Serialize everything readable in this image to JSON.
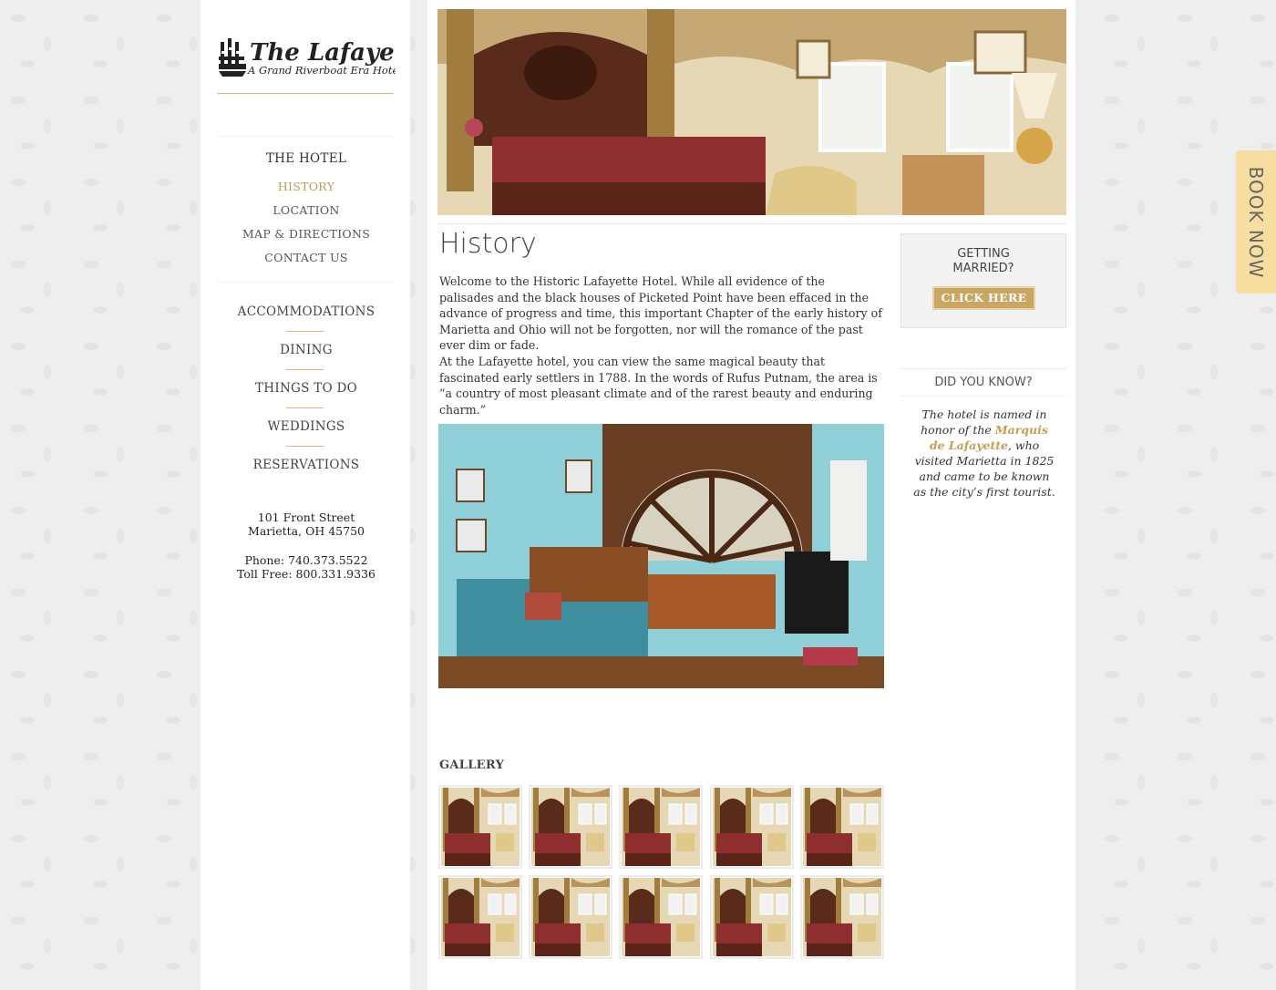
{
  "logo": {
    "name": "The Lafayette",
    "tagline": "A Grand Riverboat Era Hotel"
  },
  "nav": {
    "section_head": "THE HOTEL",
    "sub_items": [
      {
        "label": "HISTORY",
        "active": true
      },
      {
        "label": "LOCATION",
        "active": false
      },
      {
        "label": "MAP & DIRECTIONS",
        "active": false
      },
      {
        "label": "CONTACT US",
        "active": false
      }
    ],
    "main_items": [
      {
        "label": "ACCOMMODATIONS"
      },
      {
        "label": "DINING"
      },
      {
        "label": "THINGS TO DO"
      },
      {
        "label": "WEDDINGS"
      },
      {
        "label": "RESERVATIONS"
      }
    ]
  },
  "address": {
    "street": "101 Front Street",
    "city": "Marietta, OH 45750",
    "phone": "Phone: 740.373.5522",
    "toll_free": "Toll Free: 800.331.9336"
  },
  "main": {
    "title": "History",
    "paragraph_1": "Welcome to the Historic Lafayette Hotel. While all evidence of the palisades and the black houses of Picketed Point have been effaced in the advance of progress and time, this important Chapter of the early history of Marietta and Ohio will not be forgotten, nor will the romance of the past ever dim or fade.",
    "paragraph_2": "At the Lafayette hotel, you can view the same magical beauty that fascinated early settlers in 1788. In the words of Rufus Putnam, the area is “a country of most pleasant climate and of the rarest beauty and enduring charm.”",
    "gallery_title": "GALLERY"
  },
  "wedding_box": {
    "line_1": "GETTING",
    "line_2": "MARRIED?",
    "button": "CLICK HERE"
  },
  "did_you_know": {
    "title": "DID YOU KNOW?",
    "text_before": "The hotel is named in honor of the ",
    "link": "Marquis de Lafayette",
    "text_after": ", who visited Marietta in 1825 and came to be known as the city’s first tourist."
  },
  "book_now": "BOOK NOW",
  "colors": {
    "accent_gold": "#c9a661",
    "book_now_bg": "#f7dd9f",
    "active_nav": "#c09a52"
  }
}
